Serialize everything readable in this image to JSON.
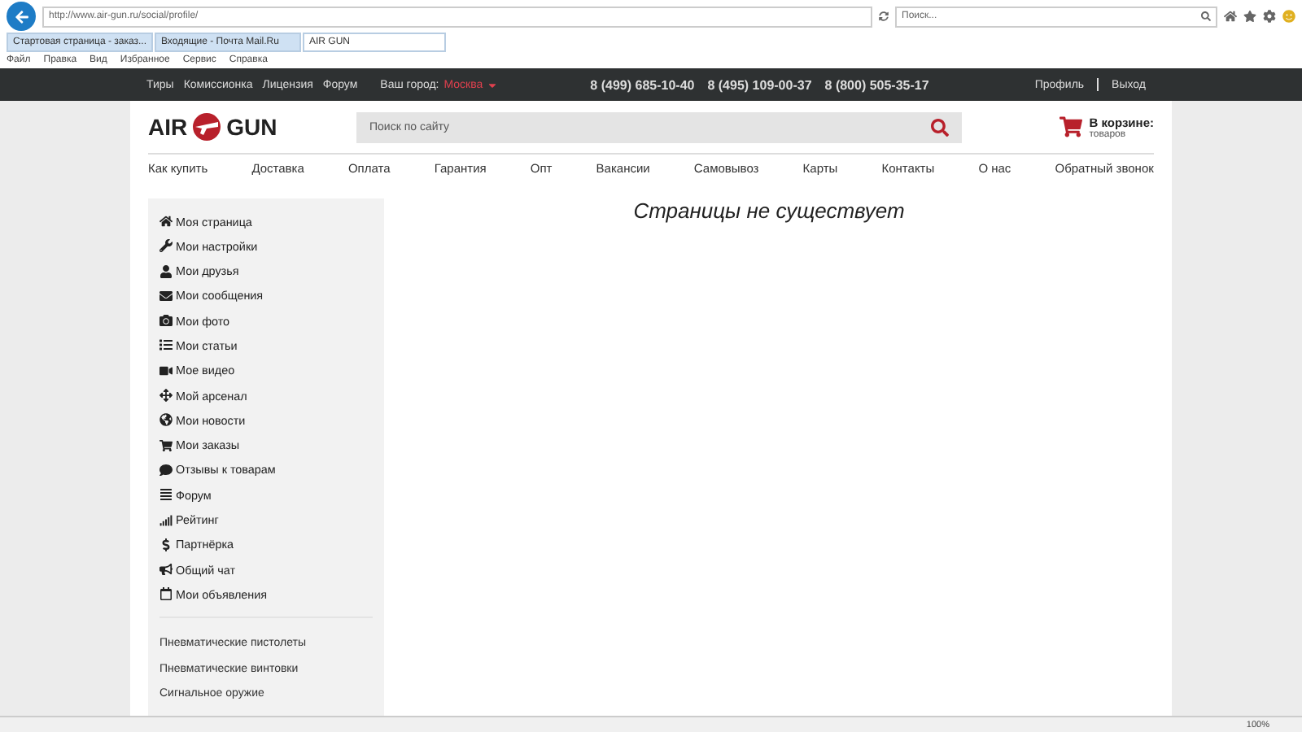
{
  "browser": {
    "url": "http://www.air-gun.ru/social/profile/",
    "search_placeholder": "Поиск...",
    "tabs": [
      {
        "label": "Стартовая страница - заказ...",
        "selected": false
      },
      {
        "label": "Входящие - Почта Mail.Ru",
        "selected": false
      },
      {
        "label": "AIR GUN",
        "selected": true
      }
    ],
    "menu": [
      "Файл",
      "Правка",
      "Вид",
      "Избранное",
      "Сервис",
      "Справка"
    ],
    "zoom": "100%"
  },
  "topbar": {
    "links": [
      "Тиры",
      "Комиссионка",
      "Лицензия",
      "Форум"
    ],
    "city_label": "Ваш город:",
    "city": "Москва",
    "phones": [
      "8 (499) 685-10-40",
      "8 (495) 109-00-37",
      "8 (800) 505-35-17"
    ],
    "account": [
      "Профиль",
      "Выход"
    ]
  },
  "header": {
    "logo_left": "AIR",
    "logo_right": "GUN",
    "search_placeholder": "Поиск по сайту",
    "cart_title": "В корзине:",
    "cart_text": "товаров"
  },
  "nav": [
    "Как купить",
    "Доставка",
    "Оплата",
    "Гарантия",
    "Опт",
    "Вакансии",
    "Самовывоз",
    "Карты",
    "Контакты",
    "О нас",
    "Обратный звонок"
  ],
  "sidebar": {
    "items": [
      "Моя страница",
      "Мои настройки",
      "Мои друзья",
      "Мои сообщения",
      "Мои фото",
      "Мои статьи",
      "Мое видео",
      "Мой арсенал",
      "Мои новости",
      "Мои заказы",
      "Отзывы к товарам",
      "Форум",
      "Рейтинг",
      "Партнёрка",
      "Общий чат",
      "Мои объявления"
    ],
    "categories": [
      "Пневматические пистолеты",
      "Пневматические винтовки",
      "Сигнальное оружие"
    ]
  },
  "main": {
    "message": "Страницы не существует"
  }
}
